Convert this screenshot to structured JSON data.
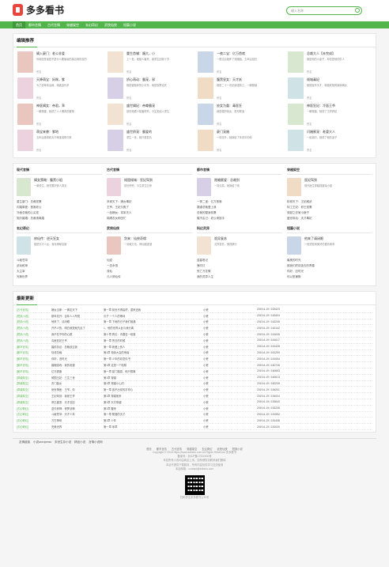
{
  "site": {
    "title": "多多看书",
    "search_placeholder": "输入名称"
  },
  "nav": [
    "首页",
    "都市言情",
    "古代言情",
    "穿越架空",
    "玄幻奇幻",
    "武侠仙侠",
    "短篇小说"
  ],
  "recommend": {
    "heading": "编辑推荐",
    "books": [
      {
        "title": "嫡入豪门：老公非爱",
        "desc": "你到底是谁是不是什么要偷偷的接近我的目的",
        "author": "佚名"
      },
      {
        "title": "重生首辅：媚大，小",
        "desc": "上一世，她被人害死，被重生回到十岁",
        "author": "佚名"
      },
      {
        "title": "一夜二宝：亿万首席",
        "desc": "一夜过后她怀了双胞胎，五年后回归",
        "author": "佚名"
      },
      {
        "title": "总裁大人【未完成】",
        "desc": "她是他的小妻子，却也是他的仇人",
        "author": "佚名"
      },
      {
        "title": "天降萌宝：妈咪，爹",
        "desc": "为了给母亲治病，她被迫代孕",
        "author": "佚名"
      },
      {
        "title": "娇心萌动：霸宠，邪",
        "desc": "她是被抛弃的小可怜，他是权势滔天",
        "author": "佚名"
      },
      {
        "title": "腹黑皇女：天才妖",
        "desc": "她是二十一世纪最强特工，一朝穿越",
        "author": "佚名"
      },
      {
        "title": "倾城毒妃",
        "desc": "她是医学天才，穿越成相府废柴嫡女",
        "author": "佚名"
      },
      {
        "title": "神医嫡女：帝君，乖",
        "desc": "一朝穿越，她成了人人唾弃的废物",
        "author": "佚名"
      },
      {
        "title": "盛世嫡妃：帝尊霸宠",
        "desc": "前世她遭人陷害惨死，今生她浴火重生",
        "author": "佚名"
      },
      {
        "title": "庶女为凰：毒医狂",
        "desc": "她是侯府庶女，受尽欺凌",
        "author": "佚名"
      },
      {
        "title": "神医狂妃：冷面王爷",
        "desc": "一朝穿越，她成了王府弃妃",
        "author": "佚名"
      },
      {
        "title": "萌宝来袭：爹地",
        "desc": "五年后她带着天才萌宝强势归来",
        "author": "佚名"
      },
      {
        "title": "盛世娇宠：霸爱的",
        "desc": "重生一世，她只想复仇",
        "author": "佚名"
      },
      {
        "title": "豪门宠婚",
        "desc": "一场意外，她嫁给了传说中的他",
        "author": "佚名"
      },
      {
        "title": "闪婚蜜宠：老婆大人",
        "desc": "一纸契约，她成了他的妻子",
        "author": "佚名"
      }
    ]
  },
  "categories": [
    {
      "name": "现代言情",
      "top": "嫡女策略：腹黑小姐",
      "top_desc": "一朝重生，她誓要护家人周全",
      "list": [
        "重生豪门：总裁宠妻",
        "闪婚厚爱：首席老公",
        "冷面总裁的心尖宠",
        "契约婚姻：总裁请离婚"
      ]
    },
    {
      "name": "古代言情",
      "top": "倾国倾城：狂妃驾到",
      "top_desc": "前世惨死，今生重生归来",
      "list": [
        "凤倾天下：嫡女毒妃",
        "王爷，王妃又跑了",
        "一品嫡女：将军夫人",
        "锦绣农女种田忙"
      ]
    },
    {
      "name": "都市言情",
      "top": "隐婚蜜爱：总裁别",
      "top_desc": "一场交易，她嫁给了他",
      "list": [
        "一夜二宝：亿万首席",
        "霸道总裁爱上我",
        "总裁的替身前妻",
        "婚不由己：老公请放手"
      ]
    },
    {
      "name": "穿越架空",
      "top": "医妃驾到",
      "top_desc": "现代医生穿越成废柴小姐",
      "list": [
        "权倾天下：王妃威武",
        "特工王妃：邪王宠妻",
        "穿越之农家小娘子",
        "盛世帝后：天才毒妃"
      ]
    },
    {
      "name": "玄幻奇幻",
      "top": "修仙传：逆天狂女",
      "top_desc": "她是天才少女，身负神秘血脉",
      "list": [
        "斗破苍穹",
        "武动乾坤",
        "大主宰",
        "完美世界"
      ]
    },
    {
      "name": "武侠仙侠",
      "top": "剑来：仙侠奇缘",
      "top_desc": "一剑破万法，修仙路漫漫",
      "list": [
        "仙逆",
        "一念永恒",
        "诛仙",
        "凡人修仙传"
      ]
    },
    {
      "name": "科幻灵异",
      "top": "诡异复苏",
      "top_desc": "灵异复苏，鬼怪横行",
      "list": [
        "盗墓笔记",
        "鬼吹灯",
        "死亡万花筒",
        "我的灵异人生"
      ]
    },
    {
      "name": "短篇小说",
      "top": "他来了请闭眼",
      "top_desc": "一段短暂而美好的爱情故事",
      "list": [
        "最美的时光",
        "致我们终将逝去的青春",
        "你好，旧时光",
        "何以笙箫默"
      ]
    }
  ],
  "updates": {
    "heading": "最新更新",
    "rows": [
      [
        "[古代言情]",
        "嫡女当家：一嫁定天下",
        "第一章 前世不得善终，重来还我",
        "小瓷",
        "2019-6-19 / 163423"
      ],
      [
        "[短篇小说]",
        "那年花开：百年人人所知",
        "引子 一个人的等待",
        "小瓷",
        "2019-6-19 / 163404"
      ],
      [
        "[短篇小说]",
        "他来了，请闭眼",
        "第一章 下雨的日子我们相遇",
        "小瓷",
        "2019-6-19 / 162235"
      ],
      [
        "[短篇小说]",
        "开不少的，明白就是就先走了",
        "1、他的世界从此与我分离",
        "小瓷",
        "2019-6-19 / 162142"
      ],
      [
        "[短篇小说]",
        "我不在乎你的心跳",
        "第十章 再见：青春告一段落",
        "小瓷",
        "2019-6-19 / 161635"
      ],
      [
        "[短篇小说]",
        "毒医狂妃王爷",
        "第一章 苍白的时候",
        "小瓷",
        "2019-6-19 / 161617"
      ],
      [
        "[都市言情]",
        "婚前协议：总裁放过我",
        "第一章 我爱上的人",
        "小瓷",
        "2019-6-19 / 161428"
      ],
      [
        "[都市言情]",
        "情诱总裁",
        "第1章 相亲大会的惊喜",
        "小瓷",
        "2019-6-19 / 161259"
      ],
      [
        "[都市言情]",
        "你好，旧时光",
        "第一章 少年的初恋情书",
        "小瓷",
        "2019-6-19 / 161054"
      ],
      [
        "[都市言情]",
        "婚姻游戏：我的老婆",
        "第1章 这是一个陷阱",
        "小瓷",
        "2019-6-19 / 160728"
      ],
      [
        "[都市言情]",
        "亿万甜妻",
        "第一章 豪门婚宴，他只想离",
        "小瓷",
        "2019-6-19 / 160653"
      ],
      [
        "[穿越架空]",
        "倾国王妃：三生三世",
        "第1章 穿越",
        "小瓷",
        "2019-6-19 / 160613"
      ],
      [
        "[穿越架空]",
        "农门医女",
        "第1章 穿越小山村",
        "小瓷",
        "2019-6-19 / 160239"
      ],
      [
        "[穿越架空]",
        "绝世神医：王爷，你",
        "第一章 逃不出你的手掌心",
        "小瓷",
        "2019-6-19 / 154201"
      ],
      [
        "[穿越架空]",
        "王妃驾到：我家王爷",
        "第1章 穿越而来",
        "小瓷",
        "2019-6-19 / 154004"
      ],
      [
        "[穿越架空]",
        "邪王盛宠：天才狂妃",
        "第1章 天才穿越",
        "小瓷",
        "2019-6-19 / 153640"
      ],
      [
        "[玄幻奇幻]",
        "逆天邪神：修罗战神",
        "第1章 醒来",
        "小瓷",
        "2019-6-19 / 152235"
      ],
      [
        "[玄幻奇幻]",
        "斗破苍穹：天才少年",
        "第一章 陨落的天才",
        "小瓷",
        "2019-6-19 / 151552"
      ],
      [
        "[玄幻奇幻]",
        "万古神帝",
        "第1章 少年",
        "小瓷",
        "2019-6-19 / 151438"
      ],
      [
        "[玄幻奇幻]",
        "完美世界",
        "第一章 序章",
        "小瓷",
        "2019-6-19 / 151030"
      ]
    ]
  },
  "footer": {
    "links_label": "友情链接",
    "links": [
      "小说wordpress",
      "末世生存小说",
      "精品小说",
      "言情小说网"
    ],
    "nav": [
      "首页",
      "都市言情",
      "古代言情",
      "穿越架空",
      "玄幻奇幻",
      "武侠仙侠",
      "短篇小说"
    ],
    "copyright": "Copyright © 2018 https://www.ddkshu.com All Rights Reserved 多多看书",
    "icp": "备案号：浙ICP备17000000号",
    "disclaimer1": "本站所有小说均由网友上传，如有侵权请联系我们删除",
    "disclaimer2": "本站不提供下载服务，所有内容仅供学习交流使用",
    "contact": "本站邮箱：contact@ddkshu.com",
    "qr_caption": "扫码关注多多看书公众号"
  },
  "cover_colors": [
    "#e9c7c0",
    "#f2e2d2",
    "#c9d6e8",
    "#d8e8d0",
    "#ecd2dc",
    "#d6cfe6",
    "#f0dcc4",
    "#cfe2e6"
  ]
}
